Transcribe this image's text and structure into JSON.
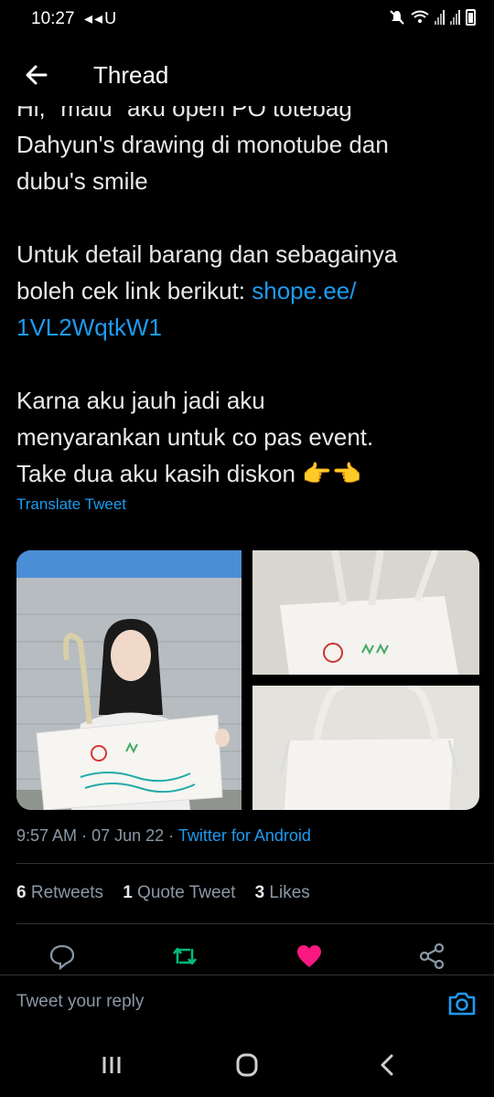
{
  "status": {
    "time": "10:27",
    "left_icons": "◂◂U"
  },
  "header": {
    "title": "Thread"
  },
  "tweet": {
    "line_partial": "Hi, \"maiu\" aku open PO totebag",
    "line2": "Dahyun's drawing di monotube dan",
    "line3": "dubu's smile",
    "line4": "Untuk detail barang dan sebagainya",
    "line5_text": "boleh cek link berikut: ",
    "line5_link": "shope.ee/",
    "line6_link": "1VL2WqtkW1",
    "line7": "Karna aku jauh jadi aku",
    "line8": "menyarankan untuk co pas event.",
    "line9": "Take dua aku kasih diskon 👉👈",
    "translate": "Translate Tweet"
  },
  "meta": {
    "time": "9:57 AM",
    "date": "07 Jun 22",
    "source": "Twitter for Android"
  },
  "stats": {
    "retweets_count": "6",
    "retweets_label": "Retweets",
    "quotes_count": "1",
    "quotes_label": "Quote Tweet",
    "likes_count": "3",
    "likes_label": "Likes"
  },
  "reply": {
    "placeholder": "Tweet your reply"
  },
  "colors": {
    "accent": "#1d9bf0",
    "retweet": "#00ba7c",
    "like": "#f91880"
  }
}
